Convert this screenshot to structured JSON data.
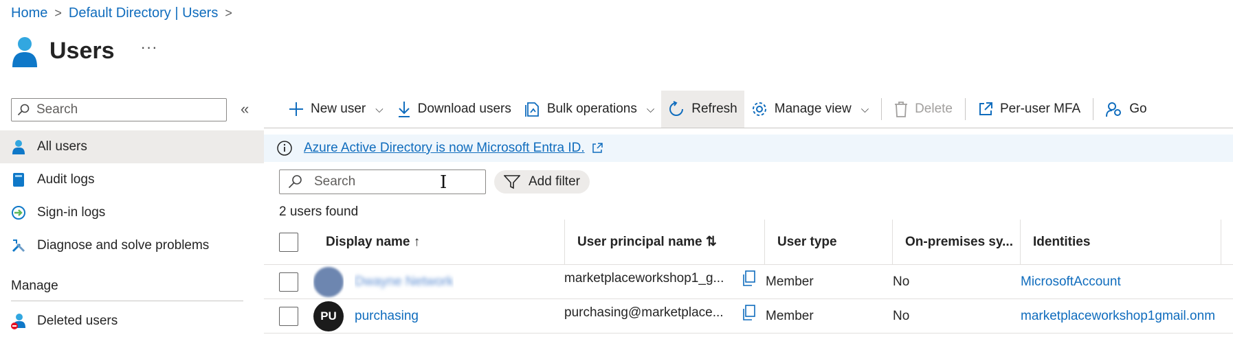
{
  "breadcrumb": {
    "home": "Home",
    "directory": "Default Directory | Users"
  },
  "header": {
    "title": "Users",
    "more": "···"
  },
  "left": {
    "search_placeholder": "Search",
    "collapse": "«",
    "items": [
      {
        "label": "All users"
      },
      {
        "label": "Audit logs"
      },
      {
        "label": "Sign-in logs"
      },
      {
        "label": "Diagnose and solve problems"
      }
    ],
    "manage_label": "Manage",
    "deleted_label": "Deleted users"
  },
  "toolbar": {
    "new_user": "New user",
    "download": "Download users",
    "bulk": "Bulk operations",
    "refresh": "Refresh",
    "manage_view": "Manage view",
    "delete": "Delete",
    "per_user_mfa": "Per-user MFA",
    "go": "Go"
  },
  "banner": {
    "text": "Azure Active Directory is now Microsoft Entra ID."
  },
  "content": {
    "search_placeholder": "Search",
    "add_filter": "Add filter",
    "count": "2 users found"
  },
  "table": {
    "headers": {
      "display_name": "Display name ↑",
      "upn": "User principal name ⇅",
      "user_type": "User type",
      "onprem": "On-premises sy...",
      "identities": "Identities"
    },
    "rows": [
      {
        "initials": "",
        "display_name": "Dwayne Network",
        "upn": "marketplaceworkshop1_g...",
        "user_type": "Member",
        "onprem": "No",
        "identities": "MicrosoftAccount"
      },
      {
        "initials": "PU",
        "display_name": "purchasing",
        "upn": "purchasing@marketplace...",
        "user_type": "Member",
        "onprem": "No",
        "identities": "marketplaceworkshop1gmail.onm"
      }
    ]
  },
  "colors": {
    "link": "#0f6cbd",
    "accent_blue": "#0078d4",
    "active_bg": "#edebe9",
    "banner_bg": "#eff6fc"
  }
}
